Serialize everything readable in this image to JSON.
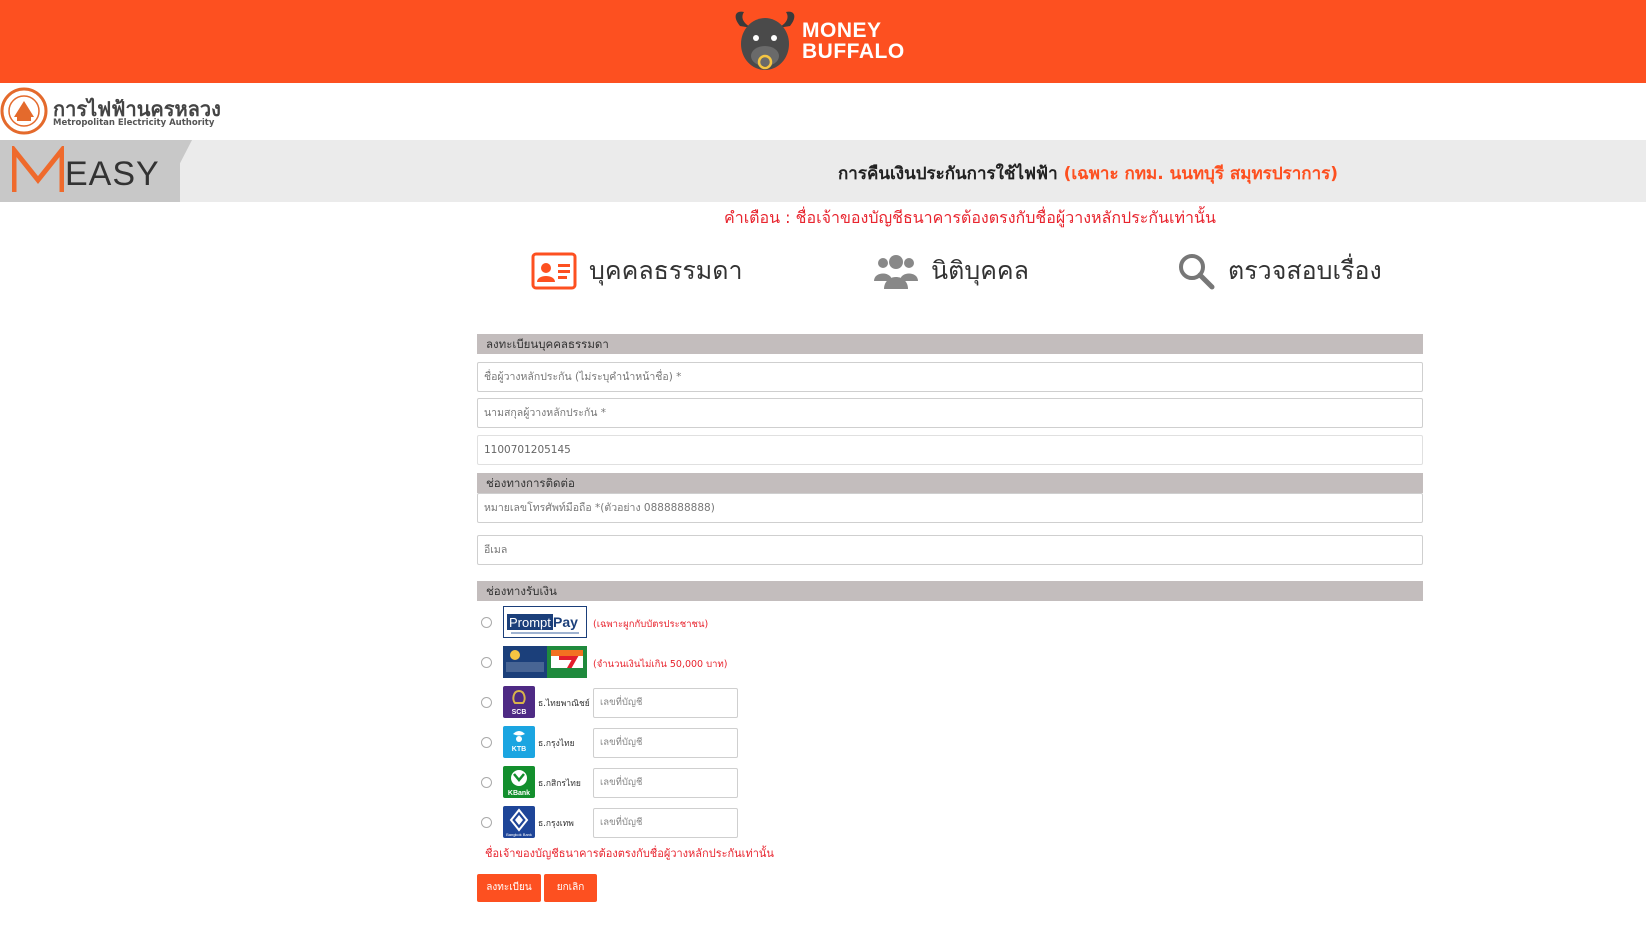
{
  "brand": {
    "line1": "MONEY",
    "line2": "BUFFALO"
  },
  "mea": {
    "name_th": "การไฟฟ้านครหลวง",
    "name_en": "Metropolitan Electricity Authority"
  },
  "banner": {
    "logo_text": "EASY",
    "title": "การคืนเงินประกันการใช้ไฟฟ้า",
    "title_highlight": "(เฉพาะ กทม. นนทบุรี สมุทรปราการ)"
  },
  "warning": "คำเตือน : ชื่อเจ้าของบัญชีธนาคารต้องตรงกับชื่อผู้วางหลักประกันเท่านั้น",
  "tabs": [
    {
      "label": "บุคคลธรรมดา",
      "icon": "id-card-icon"
    },
    {
      "label": "นิติบุคคล",
      "icon": "people-icon"
    },
    {
      "label": "ตรวจสอบเรื่อง",
      "icon": "search-icon"
    }
  ],
  "form": {
    "section_register": "ลงทะเบียนบุคคลธรรมดา",
    "first_name_placeholder": "ชื่อผู้วางหลักประกัน (ไม่ระบุคำนำหน้าชื่อ) *",
    "last_name_placeholder": "นามสกุลผู้วางหลักประกัน *",
    "account_id_value": "1100701205145",
    "section_contact": "ช่องทางการติดต่อ",
    "phone_placeholder": "หมายเลขโทรศัพท์มือถือ *(ตัวอย่าง 0888888888)",
    "email_placeholder": "อีเมล",
    "section_payment": "ช่องทางรับเงิน",
    "promptpay_note": "(เฉพาะผูกกับบัตรประชาชน)",
    "counter_note": "(จำนวนเงินไม่เกิน 50,000 บาท)",
    "account_placeholder": "เลขที่บัญชี",
    "banks": [
      {
        "name": "ธ.ไทยพาณิชย์",
        "logo_text": "SCB",
        "color": "#4e2a84"
      },
      {
        "name": "ธ.กรุงไทย",
        "logo_text": "KTB",
        "color": "#1ba5e1"
      },
      {
        "name": "ธ.กสิกรไทย",
        "logo_text": "KBank",
        "color": "#138f2d"
      },
      {
        "name": "ธ.กรุงเทพ",
        "logo_text": "Bangkok Bank",
        "color": "#1e4598"
      }
    ],
    "bottom_note": "ชื่อเจ้าของบัญชีธนาคารต้องตรงกับชื่อผู้วางหลักประกันเท่านั้น",
    "submit_label": "ลงทะเบียน",
    "cancel_label": "ยกเลิก"
  },
  "colors": {
    "accent": "#fd5020",
    "warning": "#e8242e",
    "section": "#c3bdbd"
  }
}
